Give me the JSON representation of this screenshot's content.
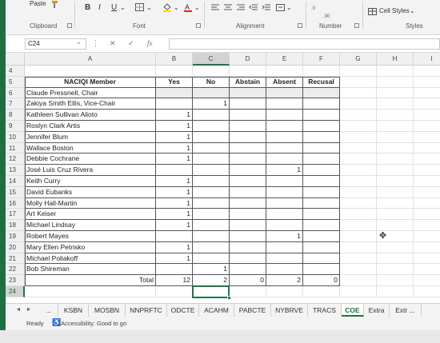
{
  "ribbon": {
    "paste_label": "Paste",
    "clipboard_label": "Clipboard",
    "font_label": "Font",
    "alignment_label": "Alignment",
    "number_label": "Number",
    "styles_label": "Styles",
    "cell_styles_label": "Cell Styles",
    "bold": "B",
    "italic": "I",
    "underline": "U"
  },
  "formula_bar": {
    "name_box": "C24",
    "fx": "fx",
    "cancel": "✕",
    "enter": "✓",
    "value": ""
  },
  "columns": [
    "A",
    "B",
    "C",
    "D",
    "E",
    "F",
    "G",
    "H",
    "I"
  ],
  "rows": [
    {
      "num": "4",
      "a": "",
      "b": "",
      "c": "",
      "d": "",
      "e": "",
      "f": ""
    },
    {
      "num": "5",
      "a": "NACIQI Member",
      "b": "Yes",
      "c": "No",
      "d": "Abstain",
      "e": "Absent",
      "f": "Recusal"
    },
    {
      "num": "6",
      "a": "Claude Pressnell, Chair",
      "b": "",
      "c": "",
      "d": "",
      "e": "",
      "f": ""
    },
    {
      "num": "7",
      "a": "Zakiya Smith Ellis, Vice-Chair",
      "b": "",
      "c": "1",
      "d": "",
      "e": "",
      "f": ""
    },
    {
      "num": "8",
      "a": "Kathleen Sullivan Alioto",
      "b": "1",
      "c": "",
      "d": "",
      "e": "",
      "f": ""
    },
    {
      "num": "9",
      "a": "Roslyn Clark Artis",
      "b": "1",
      "c": "",
      "d": "",
      "e": "",
      "f": ""
    },
    {
      "num": "10",
      "a": "Jennifer Blum",
      "b": "1",
      "c": "",
      "d": "",
      "e": "",
      "f": ""
    },
    {
      "num": "11",
      "a": "Wallace Boston",
      "b": "1",
      "c": "",
      "d": "",
      "e": "",
      "f": ""
    },
    {
      "num": "12",
      "a": "Debbie Cochrane",
      "b": "1",
      "c": "",
      "d": "",
      "e": "",
      "f": ""
    },
    {
      "num": "13",
      "a": "José Luis Cruz Rivera",
      "b": "",
      "c": "",
      "d": "",
      "e": "1",
      "f": ""
    },
    {
      "num": "14",
      "a": "Keith Curry",
      "b": "1",
      "c": "",
      "d": "",
      "e": "",
      "f": ""
    },
    {
      "num": "15",
      "a": "David Eubanks",
      "b": "1",
      "c": "",
      "d": "",
      "e": "",
      "f": ""
    },
    {
      "num": "16",
      "a": "Molly Hall-Martin",
      "b": "1",
      "c": "",
      "d": "",
      "e": "",
      "f": ""
    },
    {
      "num": "17",
      "a": "Art Keiser",
      "b": "1",
      "c": "",
      "d": "",
      "e": "",
      "f": ""
    },
    {
      "num": "18",
      "a": "Michael Lindsay",
      "b": "1",
      "c": "",
      "d": "",
      "e": "",
      "f": ""
    },
    {
      "num": "19",
      "a": "Robert Mayes",
      "b": "",
      "c": "",
      "d": "",
      "e": "1",
      "f": ""
    },
    {
      "num": "20",
      "a": "Mary Ellen Petrisko",
      "b": "1",
      "c": "",
      "d": "",
      "e": "",
      "f": ""
    },
    {
      "num": "21",
      "a": "Michael Poliakoff",
      "b": "1",
      "c": "",
      "d": "",
      "e": "",
      "f": ""
    },
    {
      "num": "22",
      "a": "Bob Shireman",
      "b": "",
      "c": "1",
      "d": "",
      "e": "",
      "f": ""
    },
    {
      "num": "23",
      "a": "Total",
      "b": "12",
      "c": "2",
      "d": "0",
      "e": "2",
      "f": "0"
    },
    {
      "num": "24",
      "a": "",
      "b": "",
      "c": "",
      "d": "",
      "e": "",
      "f": ""
    }
  ],
  "sheet_tabs": [
    "...",
    "KSBN",
    "MOSBN",
    "NNPRFTC",
    "ODCTE",
    "ACAHM",
    "PABCTE",
    "NYBRVE",
    "TRACS",
    "COE",
    "Extra",
    "Extr ..."
  ],
  "active_tab": "COE",
  "status": {
    "ready": "Ready",
    "accessibility": "Accessibility: Good to go"
  }
}
